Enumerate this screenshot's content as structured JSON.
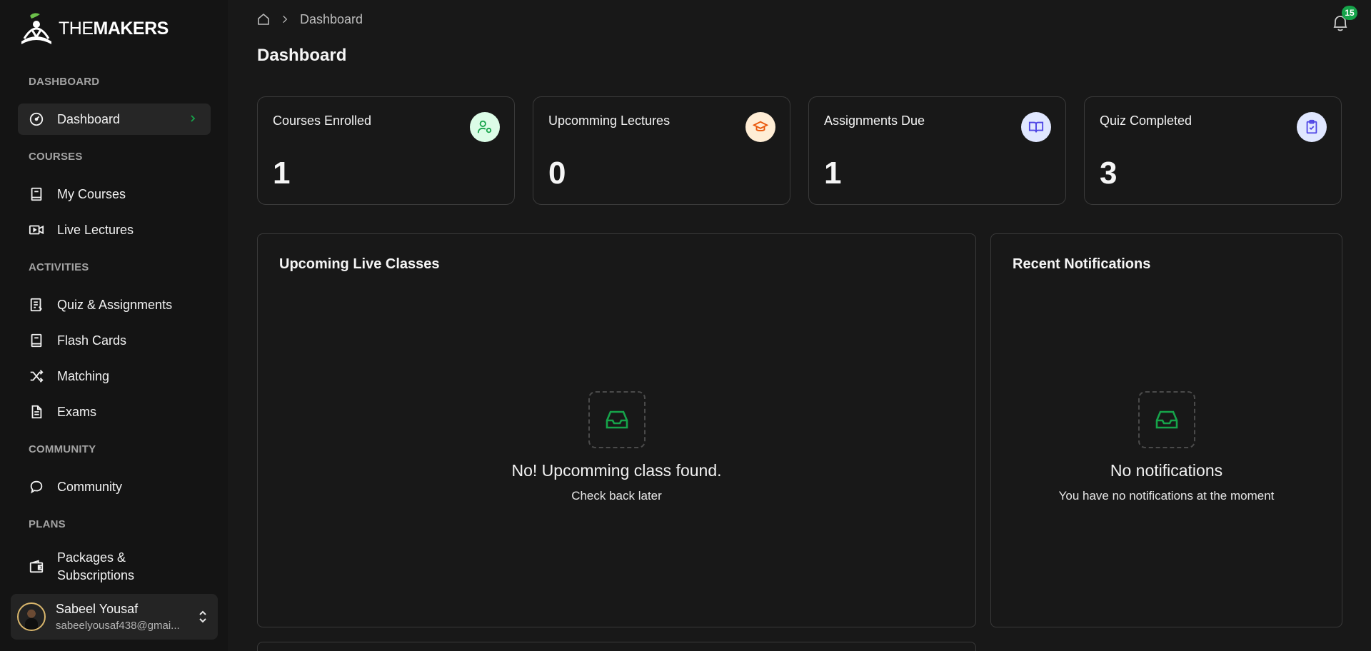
{
  "brand": {
    "name_prefix": "THE",
    "name_suffix": "MAKERS"
  },
  "sidebar": {
    "sections": [
      {
        "label": "DASHBOARD"
      },
      {
        "label": "COURSES"
      },
      {
        "label": "ACTIVITIES"
      },
      {
        "label": "COMMUNITY"
      },
      {
        "label": "PLANS"
      }
    ],
    "items": [
      {
        "label": "Dashboard",
        "icon": "gauge-icon",
        "active": true
      },
      {
        "label": "My Courses",
        "icon": "book-icon"
      },
      {
        "label": "Live Lectures",
        "icon": "video-icon"
      },
      {
        "label": "Quiz & Assignments",
        "icon": "document-list-icon"
      },
      {
        "label": "Flash Cards",
        "icon": "book-icon"
      },
      {
        "label": "Matching",
        "icon": "shuffle-icon"
      },
      {
        "label": "Exams",
        "icon": "file-text-icon"
      },
      {
        "label": "Community",
        "icon": "chat-bubble-icon"
      },
      {
        "label": "Packages & Subscriptions",
        "icon": "wallet-icon"
      }
    ],
    "user": {
      "name": "Sabeel Yousaf",
      "email": "sabeelyousaf438@gmai..."
    }
  },
  "header": {
    "breadcrumb": [
      "Dashboard"
    ],
    "notification_count": "15"
  },
  "page": {
    "title": "Dashboard"
  },
  "stats": [
    {
      "label": "Courses Enrolled",
      "value": "1",
      "icon": "user-gear-icon",
      "color": "#16a34a",
      "bg": "#dcfce7"
    },
    {
      "label": "Upcomming Lectures",
      "value": "0",
      "icon": "graduation-cap-icon",
      "color": "#ea580c",
      "bg": "#ffedd5"
    },
    {
      "label": "Assignments Due",
      "value": "1",
      "icon": "open-book-icon",
      "color": "#4f46e5",
      "bg": "#e0e7ff"
    },
    {
      "label": "Quiz Completed",
      "value": "3",
      "icon": "clipboard-check-icon",
      "color": "#4f46e5",
      "bg": "#e0e7ff"
    }
  ],
  "panels": {
    "live_classes": {
      "title": "Upcoming Live Classes",
      "empty_title": "No! Upcomming class found.",
      "empty_sub": "Check back later"
    },
    "notifications": {
      "title": "Recent Notifications",
      "empty_title": "No notifications",
      "empty_sub": "You have no notifications at the moment"
    }
  },
  "colors": {
    "accent": "#16a34a",
    "background": "#181818",
    "sidebar": "#141414",
    "border": "#3a3a3a"
  }
}
